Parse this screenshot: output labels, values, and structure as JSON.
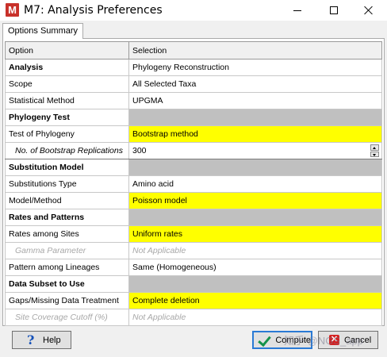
{
  "window": {
    "title": "M7: Analysis Preferences",
    "app_icon_letter": "M"
  },
  "tabs": [
    "Options Summary"
  ],
  "grid": {
    "headers": {
      "option": "Option",
      "selection": "Selection"
    },
    "rows": [
      {
        "option": "Analysis",
        "selection": "Phylogeny Reconstruction"
      },
      {
        "option": "Scope",
        "selection": "All Selected Taxa"
      },
      {
        "option": "Statistical Method",
        "selection": "UPGMA"
      },
      {
        "option": "Phylogeny Test",
        "selection": ""
      },
      {
        "option": "Test of Phylogeny",
        "selection": "Bootstrap method"
      },
      {
        "option": "No. of Bootstrap Replications",
        "selection": "300"
      },
      {
        "option": "Substitution Model",
        "selection": ""
      },
      {
        "option": "Substitutions Type",
        "selection": "Amino acid"
      },
      {
        "option": "Model/Method",
        "selection": "Poisson model"
      },
      {
        "option": "Rates and Patterns",
        "selection": ""
      },
      {
        "option": "Rates among Sites",
        "selection": "Uniform rates"
      },
      {
        "option": "Gamma Parameter",
        "selection": "Not Applicable"
      },
      {
        "option": "Pattern among Lineages",
        "selection": "Same (Homogeneous)"
      },
      {
        "option": "Data Subset to Use",
        "selection": ""
      },
      {
        "option": "Gaps/Missing Data Treatment",
        "selection": "Complete deletion"
      },
      {
        "option": "Site Coverage Cutoff (%)",
        "selection": "Not Applicable"
      }
    ]
  },
  "buttons": {
    "help": "Help",
    "compute": "Compute",
    "cancel": "Cancel"
  },
  "watermark": "知乎 @NGS_app",
  "colors": {
    "highlight": "#ffff00",
    "section_fill": "#c0c0c0",
    "disabled_text": "#a8a8a8",
    "app_icon": "#c8312a"
  },
  "icons": {
    "app": "mega-app-icon",
    "help": "question-mark-icon",
    "compute": "checkmark-icon",
    "cancel": "x-icon"
  }
}
